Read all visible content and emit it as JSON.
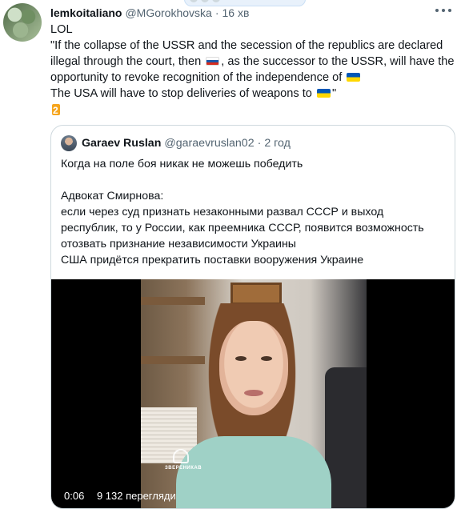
{
  "tweet": {
    "author_name": "lemkoitaliano",
    "author_handle": "@MGorokhovska",
    "separator": "·",
    "time": "16 хв",
    "text_line1": "LOL",
    "text_line2": "\"If the collapse of the USSR and the secession of the republics are declared",
    "text_line3a": "illegal through the court, then",
    "text_line3b": ", as the successor to the USSR, will have the",
    "text_line4": "opportunity to revoke recognition of the independence of",
    "text_line5": "The USA will have to stop deliveries of weapons to",
    "text_line5_end": "\""
  },
  "quote": {
    "author_name": "Garaev Ruslan",
    "author_handle": "@garaevruslan02",
    "separator": "·",
    "time": "2 год",
    "line1": "Когда на поле боя никак не можешь победить",
    "line2": "Адвокат Смирнова:",
    "line3": "если через суд признать незаконными развал СССР и выход",
    "line4": "республик, то у России, как преемника СССР, появится возможность",
    "line5": "отозвать признание независимости Украины",
    "line6": "США придётся прекратить поставки вооружения Украине"
  },
  "video": {
    "duration": "0:06",
    "views": "9 132 перегляди",
    "watermark": "ЗВЕРЕНИКАВ"
  },
  "icons": {
    "flag_russia": "flag-russia-icon",
    "flag_ukraine": "flag-ukraine-icon",
    "keycap_two": "keycap-two-icon",
    "more": "more-options-icon"
  },
  "colors": {
    "text_primary": "#0f1419",
    "text_secondary": "#536471",
    "border": "#cfd9de",
    "video_bg": "#000000"
  }
}
